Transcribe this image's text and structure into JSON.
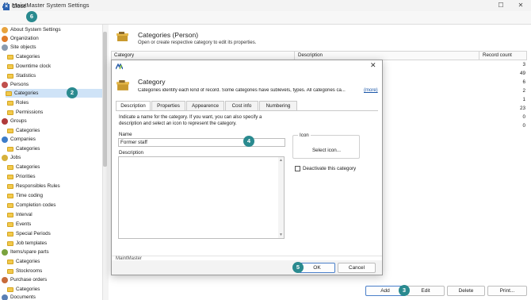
{
  "window": {
    "title": "MaintMaster System Settings"
  },
  "toolbar": {
    "close_label": "Close"
  },
  "sidebar": {
    "items": [
      {
        "label": "About System Settings"
      },
      {
        "label": "Organization"
      },
      {
        "label": "Site objects"
      },
      {
        "label": "Categories"
      },
      {
        "label": "Downtime clock"
      },
      {
        "label": "Statistics"
      },
      {
        "label": "Persons"
      },
      {
        "label": "Categories"
      },
      {
        "label": "Roles"
      },
      {
        "label": "Permissions"
      },
      {
        "label": "Groups"
      },
      {
        "label": "Categories"
      },
      {
        "label": "Companies"
      },
      {
        "label": "Categories"
      },
      {
        "label": "Jobs"
      },
      {
        "label": "Categories"
      },
      {
        "label": "Priorities"
      },
      {
        "label": "Responsibles Rules"
      },
      {
        "label": "Time coding"
      },
      {
        "label": "Completion codes"
      },
      {
        "label": "Interval"
      },
      {
        "label": "Events"
      },
      {
        "label": "Special Periods"
      },
      {
        "label": "Job templates"
      },
      {
        "label": "Items/spare parts"
      },
      {
        "label": "Categories"
      },
      {
        "label": "Stockrooms"
      },
      {
        "label": "Purchase orders"
      },
      {
        "label": "Categories"
      },
      {
        "label": "Documents"
      }
    ]
  },
  "main": {
    "title": "Categories (Person)",
    "subtitle": "Open or create respective category to edit its properties.",
    "columns": [
      "Category",
      "Description",
      "Record count"
    ],
    "record_counts": [
      "3",
      "49",
      "6",
      "2",
      "1",
      "23",
      "0",
      "0"
    ]
  },
  "buttons": {
    "add": "Add",
    "edit": "Edit",
    "delete": "Delete",
    "print": "Print..."
  },
  "dialog": {
    "title": "Category",
    "description": "Categories identify each kind of record. Some categories have sublevels, types. All categories ca...",
    "more": "(more)",
    "tabs": [
      "Description",
      "Properties",
      "Appearence",
      "Cost info",
      "Numbering"
    ],
    "intro": "Indicate a name for the category. If you want, you can also specify a description and select an icon to represent the category.",
    "name_label": "Name",
    "name_value": "Former staff",
    "description_label": "Description",
    "icon_label": "Icon",
    "select_icon": "Select icon...",
    "deactivate_label": "Deactivate this category",
    "footer_label": "MaintMaster",
    "ok": "OK",
    "cancel": "Cancel"
  },
  "callouts": [
    "6",
    "2",
    "4",
    "5",
    "3"
  ],
  "colors": {
    "accent": "#2a8a8f",
    "selection": "#cfe3f7",
    "folder": "#f2c94c"
  }
}
